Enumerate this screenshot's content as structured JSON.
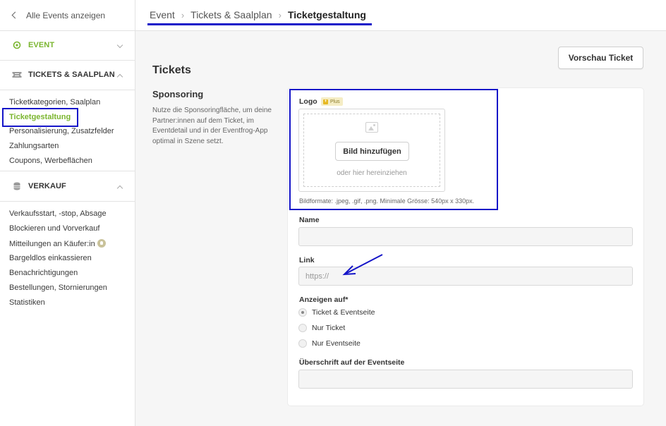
{
  "sidebar": {
    "back_label": "Alle Events anzeigen",
    "sections": [
      {
        "label": "EVENT",
        "color": "#7ab52f",
        "icon": "location-pin-icon"
      },
      {
        "label": "TICKETS & SAALPLAN",
        "color": "#333333",
        "icon": "ticket-icon"
      },
      {
        "label": "VERKAUF",
        "color": "#333333",
        "icon": "coins-icon"
      }
    ],
    "tickets_items": [
      "Ticketkategorien, Saalplan",
      "Ticketgestaltung",
      "Personalisierung, Zusatzfelder",
      "Zahlungsarten",
      "Coupons, Werbeflächen"
    ],
    "verkauf_items": [
      "Verkaufsstart, -stop, Absage",
      "Blockieren und Vorverkauf",
      "Mitteilungen an Käufer:in",
      "Bargeldlos einkassieren",
      "Benachrichtigungen",
      "Bestellungen, Stornierungen",
      "Statistiken"
    ]
  },
  "breadcrumb": {
    "items": [
      "Event",
      "Tickets & Saalplan",
      "Ticketgestaltung"
    ]
  },
  "toolbar": {
    "preview_label": "Vorschau Ticket"
  },
  "main": {
    "title": "Tickets",
    "section_title": "Sponsoring",
    "section_desc": "Nutze die Sponsoringfläche, um deine Partner:innen auf dem Ticket, im Eventdetail und in der Eventfrog-App optimal in Szene setzt."
  },
  "form": {
    "logo_label": "Logo",
    "plus_badge": "Plus",
    "add_image_label": "Bild hinzufügen",
    "drop_hint": "oder hier hereinziehen",
    "formats_hint": "Bildformate: .jpeg, .gif, .png. Minimale Grösse: 540px x 330px.",
    "name_label": "Name",
    "name_value": "",
    "link_label": "Link",
    "link_placeholder": "https://",
    "show_on_label": "Anzeigen auf*",
    "show_on_options": [
      {
        "label": "Ticket & Eventseite",
        "checked": true
      },
      {
        "label": "Nur Ticket",
        "checked": false
      },
      {
        "label": "Nur Eventseite",
        "checked": false
      }
    ],
    "heading_label": "Überschrift auf der Eventseite",
    "heading_value": ""
  },
  "colors": {
    "accent": "#7ab52f",
    "annotation": "#1515c8"
  }
}
